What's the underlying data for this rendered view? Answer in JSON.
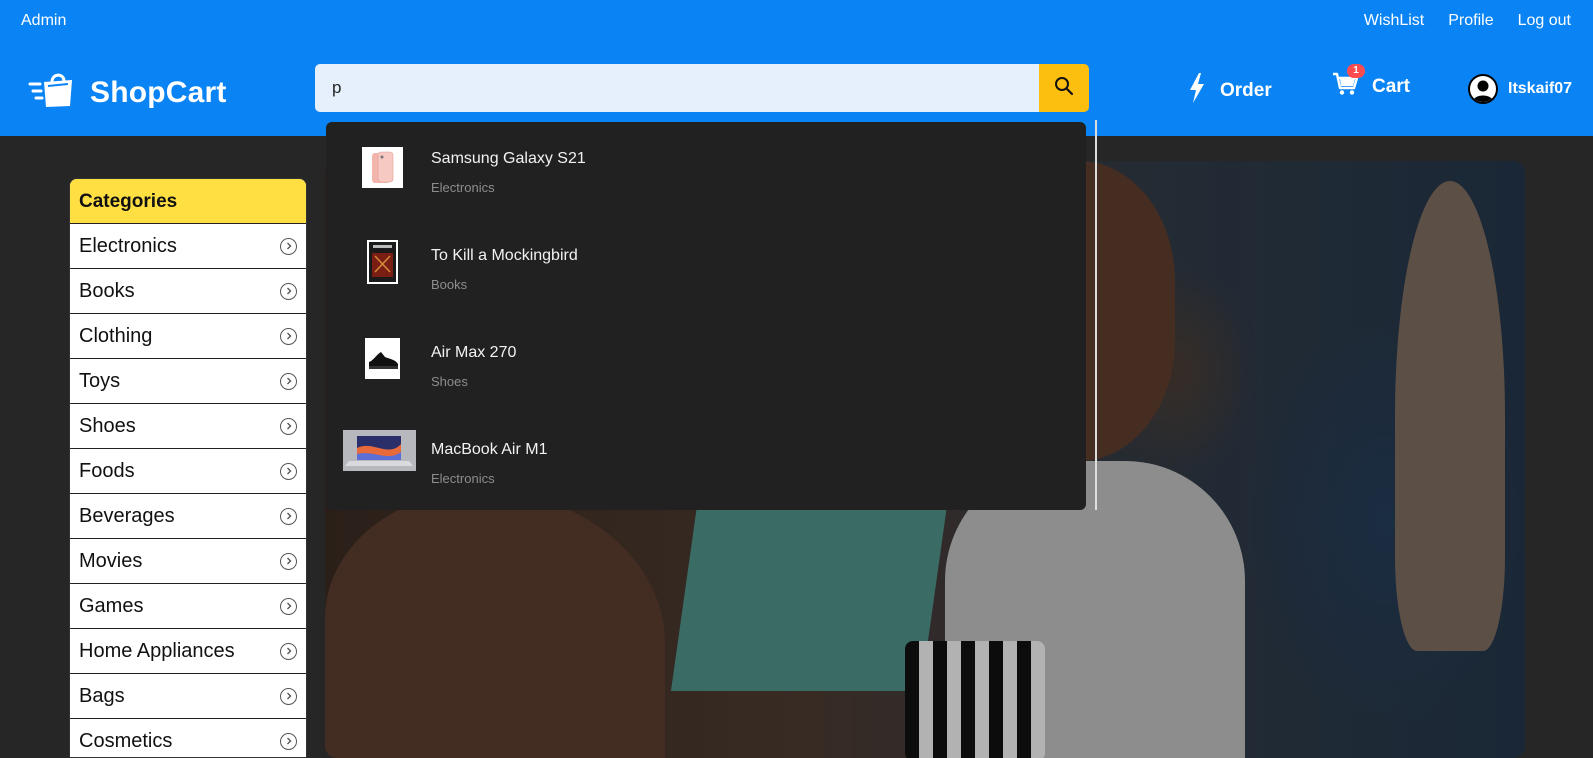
{
  "topbar": {
    "admin_label": "Admin",
    "links": [
      "WishList",
      "Profile",
      "Log out"
    ]
  },
  "header": {
    "brand": "ShopCart",
    "search_value": "p",
    "order_label": "Order",
    "cart_label": "Cart",
    "cart_badge": "1",
    "username": "Itskaif07"
  },
  "search_results": [
    {
      "name": "Samsung Galaxy S21",
      "category": "Electronics",
      "icon": "phone-thumbnail"
    },
    {
      "name": "To Kill a Mockingbird",
      "category": "Books",
      "icon": "book-thumbnail"
    },
    {
      "name": "Air Max 270",
      "category": "Shoes",
      "icon": "sneaker-thumbnail"
    },
    {
      "name": "MacBook Air M1",
      "category": "Electronics",
      "icon": "laptop-thumbnail"
    }
  ],
  "sidebar": {
    "title": "Categories",
    "items": [
      "Electronics",
      "Books",
      "Clothing",
      "Toys",
      "Shoes",
      "Foods",
      "Beverages",
      "Movies",
      "Games",
      "Home Appliances",
      "Bags",
      "Cosmetics"
    ]
  },
  "colors": {
    "primary": "#0a84f5",
    "search_button": "#fdbf0f",
    "categories_header": "#ffdf42",
    "dropdown_bg": "#212121"
  }
}
